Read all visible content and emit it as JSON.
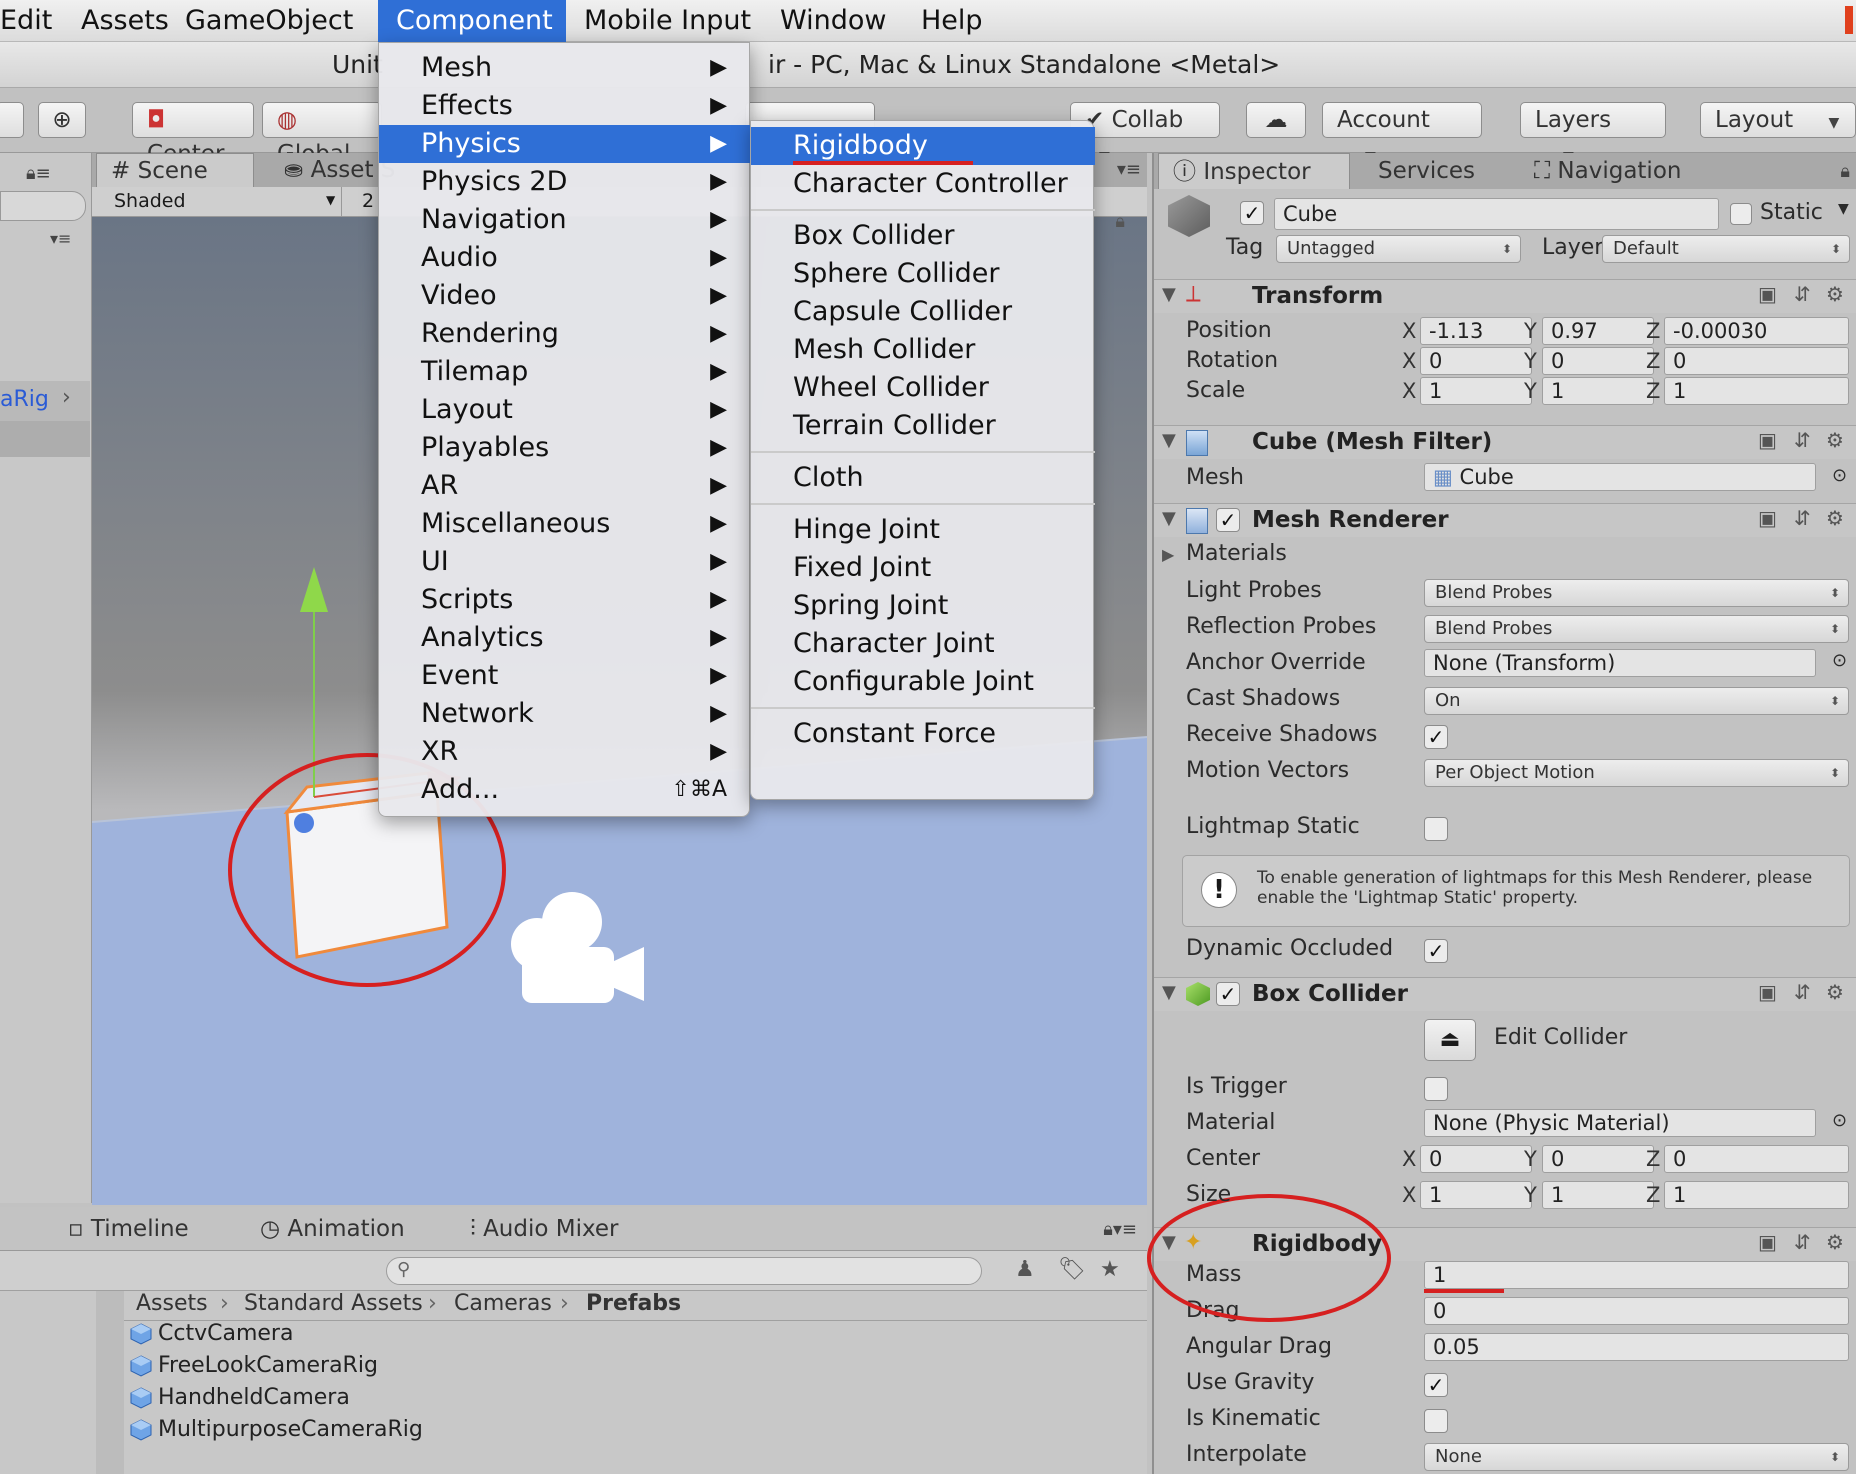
{
  "menubar": {
    "items": [
      "Edit",
      "Assets",
      "GameObject",
      "Component",
      "Mobile Input",
      "Window",
      "Help"
    ],
    "active": "Component"
  },
  "titlebar": {
    "left_text": "Unit",
    "right_text": "ir - PC, Mac & Linux Standalone <Metal>"
  },
  "toolbar": {
    "center_label": "Center",
    "global_label": "Global",
    "collab_label": "Collab",
    "account_label": "Account",
    "layers_label": "Layers",
    "layout_label": "Layout"
  },
  "scene_panel": {
    "tab_scene": "Scene",
    "tab_asset": "Asset S",
    "shading_mode": "Shaded",
    "mode_2d": "2",
    "left_item": "aRig"
  },
  "component_menu": {
    "items": [
      {
        "label": "Mesh",
        "submenu": true
      },
      {
        "label": "Effects",
        "submenu": true
      },
      {
        "label": "Physics",
        "submenu": true
      },
      {
        "label": "Physics 2D",
        "submenu": true
      },
      {
        "label": "Navigation",
        "submenu": true
      },
      {
        "label": "Audio",
        "submenu": true
      },
      {
        "label": "Video",
        "submenu": true
      },
      {
        "label": "Rendering",
        "submenu": true
      },
      {
        "label": "Tilemap",
        "submenu": true
      },
      {
        "label": "Layout",
        "submenu": true
      },
      {
        "label": "Playables",
        "submenu": true
      },
      {
        "label": "AR",
        "submenu": true
      },
      {
        "label": "Miscellaneous",
        "submenu": true
      },
      {
        "label": "UI",
        "submenu": true
      },
      {
        "label": "Scripts",
        "submenu": true
      },
      {
        "label": "Analytics",
        "submenu": true
      },
      {
        "label": "Event",
        "submenu": true
      },
      {
        "label": "Network",
        "submenu": true
      },
      {
        "label": "XR",
        "submenu": true
      },
      {
        "label": "Add...",
        "shortcut": "⇧⌘A"
      }
    ],
    "selected": "Physics"
  },
  "physics_submenu": {
    "groups": [
      [
        "Rigidbody",
        "Character Controller"
      ],
      [
        "Box Collider",
        "Sphere Collider",
        "Capsule Collider",
        "Mesh Collider",
        "Wheel Collider",
        "Terrain Collider"
      ],
      [
        "Cloth"
      ],
      [
        "Hinge Joint",
        "Fixed Joint",
        "Spring Joint",
        "Character Joint",
        "Configurable Joint"
      ],
      [
        "Constant Force"
      ]
    ],
    "selected": "Rigidbody"
  },
  "bottom_panel": {
    "tabs": [
      "Timeline",
      "Animation",
      "Audio Mixer"
    ],
    "breadcrumb": [
      "Assets",
      "Standard Assets",
      "Cameras",
      "Prefabs"
    ],
    "assets": [
      "CctvCamera",
      "FreeLookCameraRig",
      "HandheldCamera",
      "MultipurposeCameraRig"
    ]
  },
  "inspector": {
    "tabs": [
      "Inspector",
      "Services",
      "Navigation"
    ],
    "object_name": "Cube",
    "static_label": "Static",
    "tag_label": "Tag",
    "tag_value": "Untagged",
    "layer_label": "Layer",
    "layer_value": "Default",
    "transform": {
      "title": "Transform",
      "position_label": "Position",
      "position": [
        "-1.13",
        "0.97",
        "-0.00030"
      ],
      "rotation_label": "Rotation",
      "rotation": [
        "0",
        "0",
        "0"
      ],
      "scale_label": "Scale",
      "scale": [
        "1",
        "1",
        "1"
      ]
    },
    "mesh_filter": {
      "title": "Cube (Mesh Filter)",
      "mesh_label": "Mesh",
      "mesh_value": "Cube"
    },
    "mesh_renderer": {
      "title": "Mesh Renderer",
      "materials_label": "Materials",
      "light_probes_label": "Light Probes",
      "light_probes_value": "Blend Probes",
      "reflection_probes_label": "Reflection Probes",
      "reflection_probes_value": "Blend Probes",
      "anchor_override_label": "Anchor Override",
      "anchor_override_value": "None (Transform)",
      "cast_shadows_label": "Cast Shadows",
      "cast_shadows_value": "On",
      "receive_shadows_label": "Receive Shadows",
      "motion_vectors_label": "Motion Vectors",
      "motion_vectors_value": "Per Object Motion",
      "lightmap_static_label": "Lightmap Static",
      "info_text_1": "To enable generation of lightmaps for this Mesh Renderer, please",
      "info_text_2": "enable the 'Lightmap Static' property.",
      "dynamic_occluded_label": "Dynamic Occluded"
    },
    "box_collider": {
      "title": "Box Collider",
      "edit_collider_label": "Edit Collider",
      "is_trigger_label": "Is Trigger",
      "material_label": "Material",
      "material_value": "None (Physic Material)",
      "center_label": "Center",
      "center": [
        "0",
        "0",
        "0"
      ],
      "size_label": "Size",
      "size": [
        "1",
        "1",
        "1"
      ]
    },
    "rigidbody": {
      "title": "Rigidbody",
      "mass_label": "Mass",
      "mass_value": "1",
      "drag_label": "Drag",
      "drag_value": "0",
      "angular_drag_label": "Angular Drag",
      "angular_drag_value": "0.05",
      "use_gravity_label": "Use Gravity",
      "is_kinematic_label": "Is Kinematic",
      "interpolate_label": "Interpolate",
      "interpolate_value": "None"
    }
  },
  "axis_labels": {
    "x": "X",
    "y": "Y",
    "z": "Z"
  },
  "colors": {
    "highlight": "#2f6fd6",
    "annotation": "#d62020"
  }
}
